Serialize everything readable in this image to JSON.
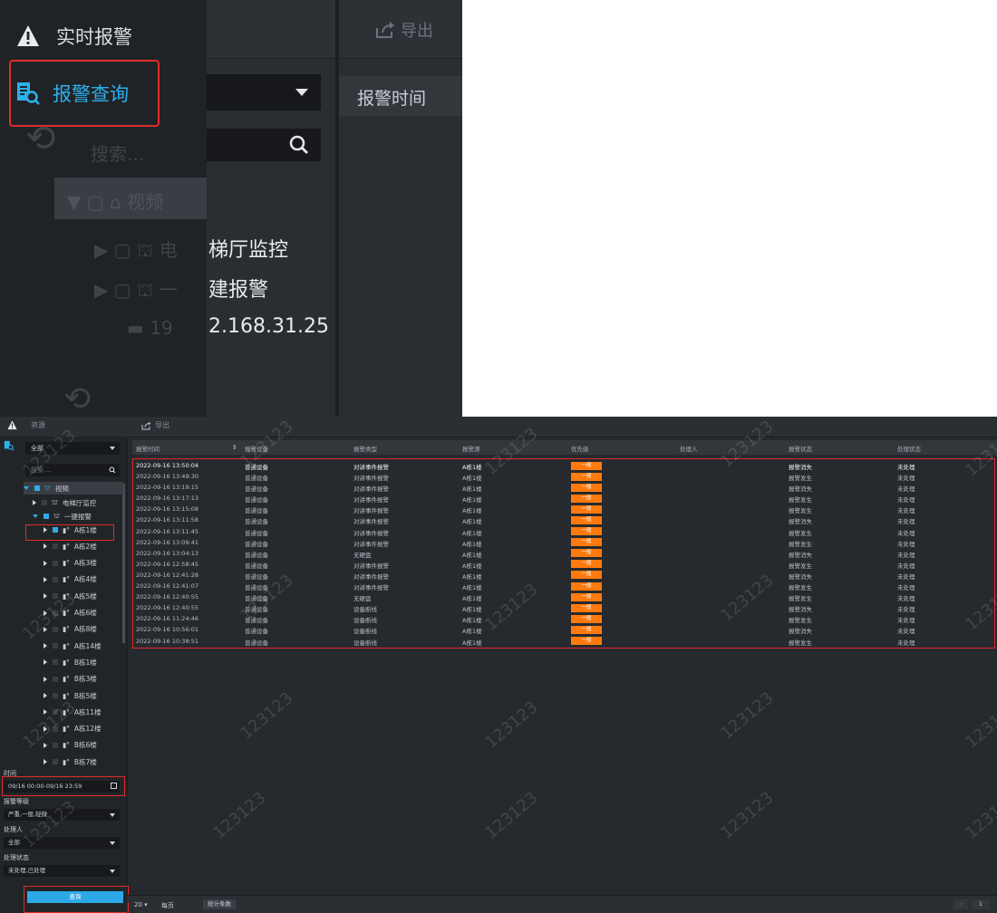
{
  "zoom": {
    "alert_label": "实时报警",
    "query_label": "报警查询",
    "export_label": "导出",
    "search_placeholder": "搜索...",
    "header_col": "报警时间",
    "video_label": "视频",
    "tree": [
      {
        "ghost": "电",
        "text": "梯厅监控"
      },
      {
        "ghost": "一",
        "text": "建报警"
      },
      {
        "ghost": "19",
        "text": "2.168.31.25"
      }
    ]
  },
  "app": {
    "resource_label": "资源",
    "export_label": "导出",
    "group_select": "全部",
    "search_placeholder": "搜索....",
    "tree": {
      "root": "视频",
      "elevator": "电梯厅监控",
      "onekey": "一键报警",
      "buildings": [
        "A栋1楼",
        "A栋2楼",
        "A栋3楼",
        "A栋4楼",
        "A栋5楼",
        "A栋6楼",
        "A栋8楼",
        "A栋14楼",
        "B栋1楼",
        "B栋3楼",
        "B栋5楼",
        "A栋11楼",
        "A栋12楼",
        "B栋6楼",
        "B栋7楼"
      ]
    },
    "filters": {
      "time_label": "时间",
      "time_value": "09/16 00:00-09/16 23:59",
      "level_label": "报警等级",
      "level_value": "严重,一般,轻微",
      "handler_label": "处理人",
      "handler_value": "全部",
      "status_label": "处理状态",
      "status_value": "未处理,已处理",
      "query_button": "查询"
    },
    "columns": [
      "报警时间",
      "报警设备",
      "报警类型",
      "报警源",
      "优先级",
      "处理人",
      "报警状态",
      "处理状态"
    ],
    "rows": [
      [
        "2022-09-16 13:50:04",
        "普通设备",
        "对讲事件报警",
        "A栋1楼",
        "一般",
        "",
        "报警消失",
        "未处理"
      ],
      [
        "2022-09-16 13:49:30",
        "普通设备",
        "对讲事件报警",
        "A栋1楼",
        "一般",
        "",
        "报警发生",
        "未处理"
      ],
      [
        "2022-09-16 13:19:15",
        "普通设备",
        "对讲事件报警",
        "A栋1楼",
        "一般",
        "",
        "报警消失",
        "未处理"
      ],
      [
        "2022-09-16 13:17:13",
        "普通设备",
        "对讲事件报警",
        "A栋1楼",
        "一般",
        "",
        "报警发生",
        "未处理"
      ],
      [
        "2022-09-16 13:15:08",
        "普通设备",
        "对讲事件报警",
        "A栋1楼",
        "一般",
        "",
        "报警发生",
        "未处理"
      ],
      [
        "2022-09-16 13:11:58",
        "普通设备",
        "对讲事件报警",
        "A栋1楼",
        "一般",
        "",
        "报警消失",
        "未处理"
      ],
      [
        "2022-09-16 13:11:45",
        "普通设备",
        "对讲事件报警",
        "A栋1楼",
        "一般",
        "",
        "报警发生",
        "未处理"
      ],
      [
        "2022-09-16 13:09:41",
        "普通设备",
        "对讲事件报警",
        "A栋1楼",
        "一般",
        "",
        "报警发生",
        "未处理"
      ],
      [
        "2022-09-16 13:04:13",
        "普通设备",
        "无硬盘",
        "A栋1楼",
        "一般",
        "",
        "报警消失",
        "未处理"
      ],
      [
        "2022-09-16 12:58:45",
        "普通设备",
        "对讲事件报警",
        "A栋1楼",
        "一般",
        "",
        "报警发生",
        "未处理"
      ],
      [
        "2022-09-16 12:41:28",
        "普通设备",
        "对讲事件报警",
        "A栋1楼",
        "一般",
        "",
        "报警消失",
        "未处理"
      ],
      [
        "2022-09-16 12:41:07",
        "普通设备",
        "对讲事件报警",
        "A栋1楼",
        "一般",
        "",
        "报警发生",
        "未处理"
      ],
      [
        "2022-09-16 12:40:55",
        "普通设备",
        "无硬盘",
        "A栋1楼",
        "一般",
        "",
        "报警发生",
        "未处理"
      ],
      [
        "2022-09-16 12:40:55",
        "普通设备",
        "设备断线",
        "A栋1楼",
        "一般",
        "",
        "报警消失",
        "未处理"
      ],
      [
        "2022-09-16 11:24:46",
        "普通设备",
        "设备断线",
        "A栋1楼",
        "一般",
        "",
        "报警发生",
        "未处理"
      ],
      [
        "2022-09-16 10:56:01",
        "普通设备",
        "设备断线",
        "A栋1楼",
        "一般",
        "",
        "报警消失",
        "未处理"
      ],
      [
        "2022-09-16 10:38:51",
        "普通设备",
        "设备断线",
        "A栋1楼",
        "一般",
        "",
        "报警发生",
        "未处理"
      ]
    ],
    "footer": {
      "page_size": "20",
      "per_page": "每页",
      "stats_button": "统计条数",
      "page_number": "1"
    },
    "watermark": "123123"
  }
}
